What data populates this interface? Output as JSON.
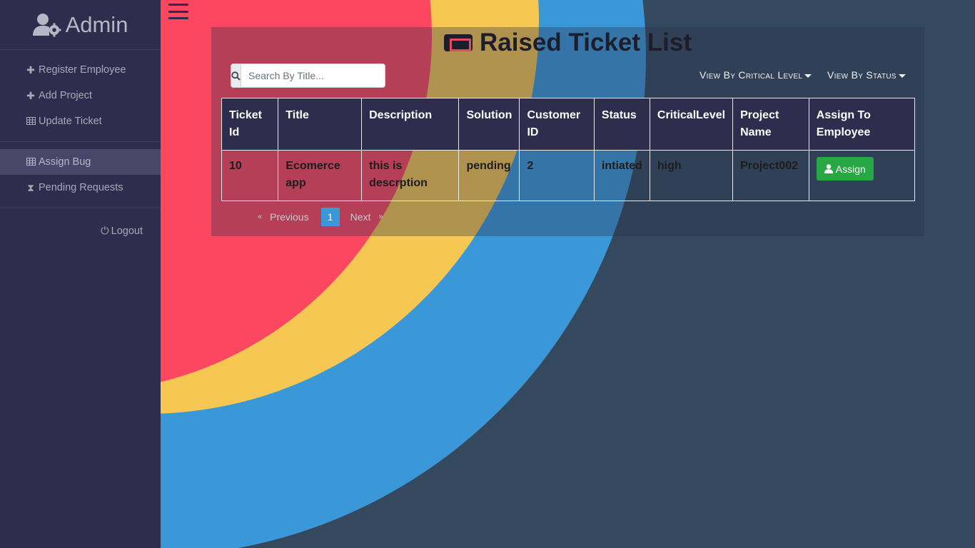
{
  "sidebar": {
    "brand": "Admin",
    "brand_icon": "user-gear-icon",
    "items": [
      {
        "label": "Register Employee",
        "icon": "plus-icon"
      },
      {
        "label": "Add Project",
        "icon": "plus-icon"
      },
      {
        "label": "Update Ticket",
        "icon": "table-icon"
      },
      {
        "label": "Assign Bug",
        "icon": "table-icon",
        "active": true
      },
      {
        "label": "Pending Requests",
        "icon": "hourglass-icon"
      }
    ],
    "logout": "Logout"
  },
  "main": {
    "title": "Raised Ticket List",
    "search": {
      "placeholder": "Search By Title...",
      "value": ""
    },
    "filters": {
      "critical": "View By Critical Level",
      "status": "View By Status"
    },
    "table": {
      "headers": [
        "Ticket Id",
        "Title",
        "Description",
        "Solution",
        "Customer ID",
        "Status",
        "CriticalLevel",
        "Project Name",
        "Assign To Employee"
      ],
      "rows": [
        {
          "ticket_id": "10",
          "title": "Ecomerce app",
          "description": "this is descrption",
          "solution": "pending",
          "customer_id": "2",
          "status": "intiated",
          "critical_level": "high",
          "project_name": "Project002",
          "action": "Assign"
        }
      ]
    },
    "pagination": {
      "previous": "Previous",
      "current": "1",
      "next": "Next",
      "prev_arrow": "«",
      "next_arrow": "»"
    }
  },
  "colors": {
    "sidebar_bg": "#2e2d4d",
    "accent_blue": "#3a98d9",
    "accent_yellow": "#f7c754",
    "accent_red": "#fd4760",
    "button_green": "#28a745",
    "page_bg": "#34495e"
  }
}
